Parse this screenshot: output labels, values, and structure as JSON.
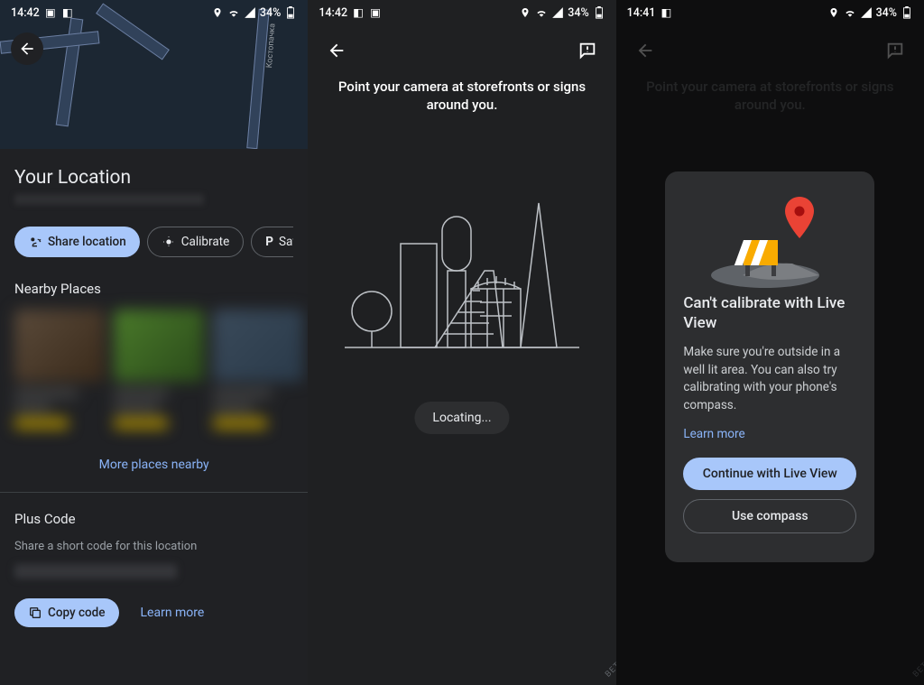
{
  "status": {
    "time_a": "14:42",
    "time_b": "14:42",
    "time_c": "14:41",
    "battery": "34%"
  },
  "screen1": {
    "map_street_label": "Костопачка",
    "title": "Your Location",
    "chips": {
      "share": "Share location",
      "calibrate": "Calibrate",
      "save_parking": "Save park"
    },
    "nearby_heading": "Nearby Places",
    "more_places": "More places nearby",
    "plus_heading": "Plus Code",
    "plus_sub": "Share a short code for this location",
    "copy_code": "Copy code",
    "learn_more": "Learn more"
  },
  "screen2": {
    "instruction": "Point your camera at storefronts or signs around you.",
    "locating": "Locating...",
    "beta": "BETA"
  },
  "screen3": {
    "instruction": "Point your camera at storefronts or signs around you.",
    "card": {
      "title": "Can't calibrate with Live View",
      "body": "Make sure you're outside in a well lit area. You can also try calibrating with your phone's compass.",
      "learn_more": "Learn more",
      "continue_btn": "Continue with Live View",
      "compass_btn": "Use compass"
    },
    "beta": "BETA"
  }
}
